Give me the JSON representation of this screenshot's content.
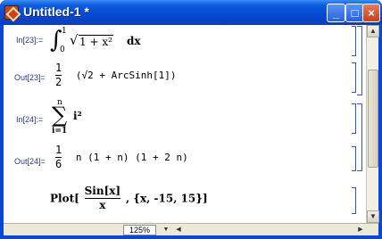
{
  "window": {
    "title": "Untitled-1 *",
    "min_label": "_",
    "max_label": "□",
    "close_label": "×"
  },
  "cells": [
    {
      "label": "In[23]:=",
      "kind": "input",
      "expr": {
        "int_upper": "1",
        "int_lower": "0",
        "integrand": "1 + x²",
        "dx": "dx"
      }
    },
    {
      "label": "Out[23]=",
      "kind": "output",
      "expr": {
        "num": "1",
        "den": "2",
        "body": "(√2 + ArcSinh[1])"
      }
    },
    {
      "label": "In[24]:=",
      "kind": "input",
      "expr": {
        "sum_upper": "n",
        "sum_lower": "i=1",
        "summand": "i²"
      }
    },
    {
      "label": "Out[24]=",
      "kind": "output",
      "expr": {
        "num": "1",
        "den": "6",
        "body": "n (1 + n) (1 + 2 n)"
      }
    },
    {
      "label": "",
      "kind": "input",
      "expr": {
        "head": "Plot[",
        "num": "Sin[x]",
        "den": "x",
        "tail": ", {x, -15, 15}]"
      }
    }
  ],
  "status": {
    "zoom": "125%"
  },
  "colors": {
    "title_bar": "#0548d0",
    "bracket": "#3a55b0",
    "label": "#2a3a8a"
  }
}
